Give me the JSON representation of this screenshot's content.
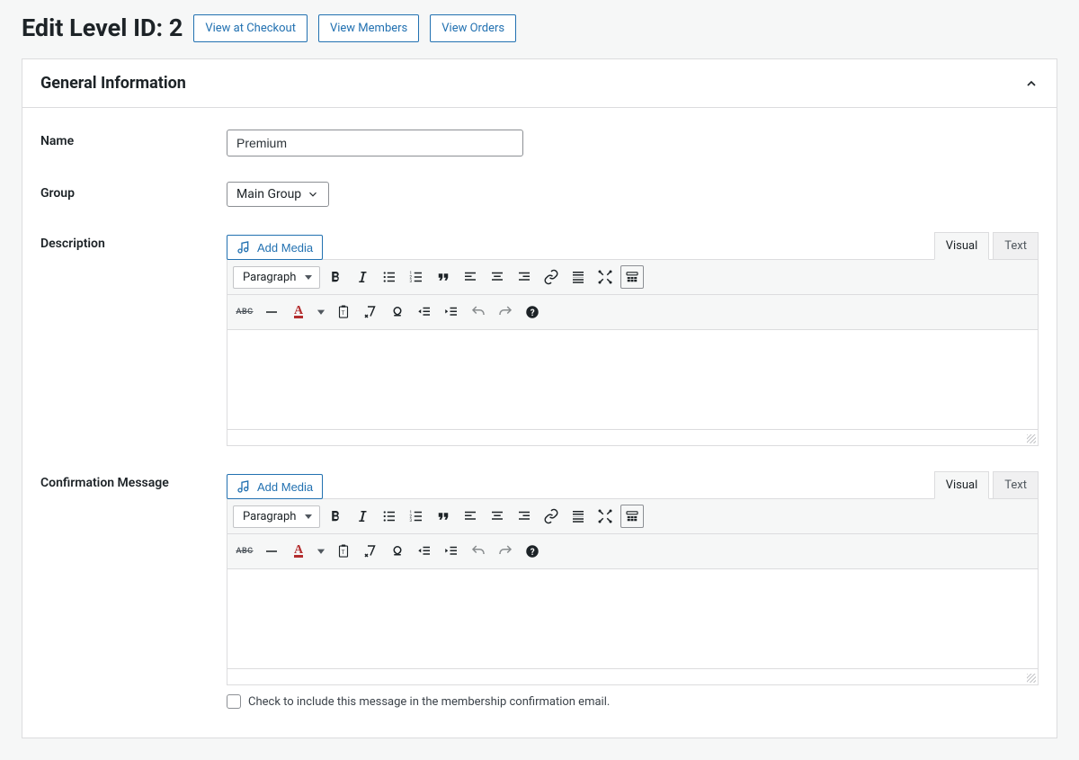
{
  "header": {
    "title": "Edit Level ID: 2",
    "buttons": {
      "viewCheckout": "View at Checkout",
      "viewMembers": "View Members",
      "viewOrders": "View Orders"
    }
  },
  "panel": {
    "title": "General Information"
  },
  "form": {
    "name": {
      "label": "Name",
      "value": "Premium"
    },
    "group": {
      "label": "Group",
      "selected": "Main Group"
    },
    "description": {
      "label": "Description",
      "addMedia": "Add Media"
    },
    "confirmation": {
      "label": "Confirmation Message",
      "addMedia": "Add Media",
      "checkboxLabel": "Check to include this message in the membership confirmation email."
    }
  },
  "editor": {
    "tabVisual": "Visual",
    "tabText": "Text",
    "formatSelect": "Paragraph"
  }
}
